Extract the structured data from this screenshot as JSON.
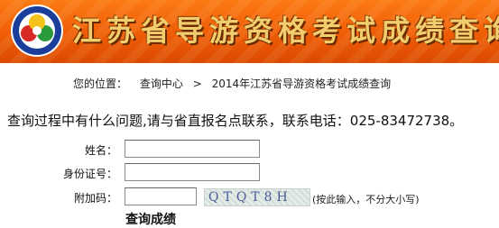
{
  "header": {
    "title": "江苏省导游资格考试成绩查询",
    "logo_icon": "provincial-logo-icon",
    "colors": {
      "band": "#ee5c06",
      "title": "#f2cd6e"
    }
  },
  "breadcrumb": {
    "label": "您的位置：",
    "items": [
      "查询中心",
      "2014年江苏省导游资格考试成绩查询"
    ],
    "separator": ">"
  },
  "notice": "查询过程中有什么问题,请与省直报名点联系，联系电话：025-83472738。",
  "form": {
    "name_label": "姓名：",
    "name_value": "",
    "id_label": "身份证号：",
    "id_value": "",
    "captcha_label": "附加码：",
    "captcha_value": "",
    "captcha_code": "QTQT8H",
    "captcha_hint": "(按此输入，不分大小写)",
    "submit_label": "查询成绩"
  }
}
